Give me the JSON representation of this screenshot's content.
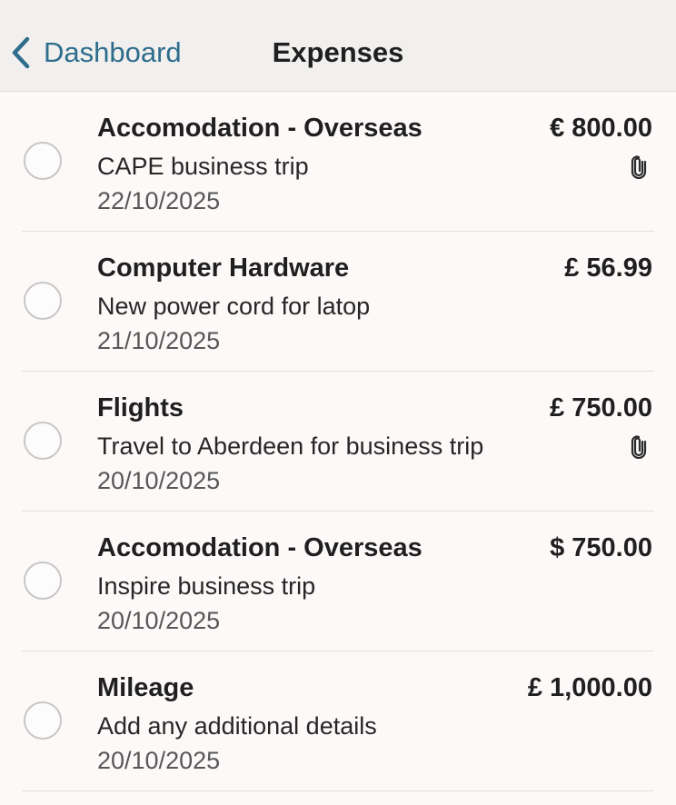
{
  "header": {
    "back_label": "Dashboard",
    "title": "Expenses"
  },
  "expenses": [
    {
      "title": "Accomodation - Overseas",
      "description": "CAPE business trip",
      "date": "22/10/2025",
      "amount": "€ 800.00",
      "has_attachment": true
    },
    {
      "title": "Computer Hardware",
      "description": "New power cord for latop",
      "date": "21/10/2025",
      "amount": "£ 56.99",
      "has_attachment": false
    },
    {
      "title": "Flights",
      "description": "Travel to Aberdeen for business trip",
      "date": "20/10/2025",
      "amount": "£ 750.00",
      "has_attachment": true
    },
    {
      "title": "Accomodation - Overseas",
      "description": "Inspire business trip",
      "date": "20/10/2025",
      "amount": "$ 750.00",
      "has_attachment": false
    },
    {
      "title": "Mileage",
      "description": "Add any additional details",
      "date": "20/10/2025",
      "amount": "£ 1,000.00",
      "has_attachment": false
    }
  ],
  "icons": {
    "back": "chevron-left-icon",
    "attachment": "paperclip-icon",
    "select": "radio-unchecked-icon"
  },
  "colors": {
    "accent": "#2f6d8c",
    "header_bg": "#f1f0ef",
    "page_bg": "#fcf9f8",
    "divider": "#e3e1df"
  }
}
